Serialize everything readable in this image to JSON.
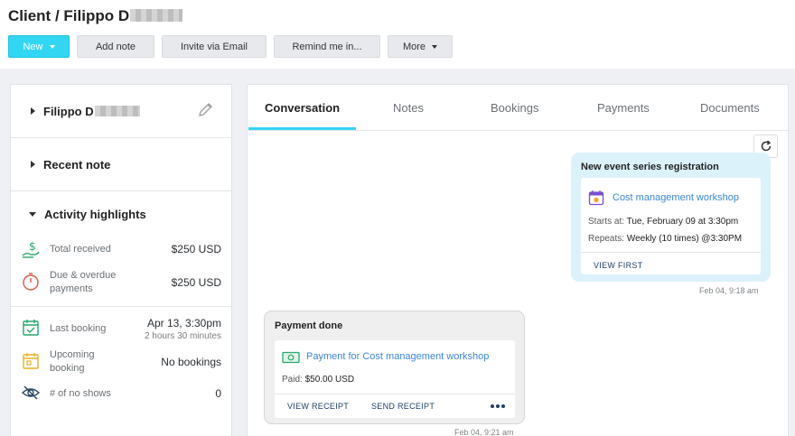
{
  "header": {
    "title": "Client / Filippo D",
    "buttons": {
      "new": "New",
      "add_note": "Add note",
      "invite": "Invite via Email",
      "remind": "Remind me in...",
      "more": "More"
    }
  },
  "left_panel": {
    "client_name": "Filippo D",
    "recent_note": "Recent note",
    "activity_title": "Activity highlights",
    "rows": {
      "total_received": {
        "label": "Total received",
        "value": "$250 USD"
      },
      "due_overdue": {
        "label": "Due & overdue payments",
        "value": "$250 USD"
      },
      "last_booking": {
        "label": "Last booking",
        "value": "Apr 13, 3:30pm",
        "sub": "2 hours 30 minutes"
      },
      "upcoming_booking": {
        "label": "Upcoming booking",
        "value": "No bookings"
      },
      "no_shows": {
        "label": "# of no shows",
        "value": "0"
      }
    }
  },
  "tabs": [
    "Conversation",
    "Notes",
    "Bookings",
    "Payments",
    "Documents"
  ],
  "active_tab": "Conversation",
  "colors": {
    "accent": "#33d6f2",
    "link": "#3b86d8",
    "bubble_blue": "#dcf2fb"
  },
  "messages": {
    "registration": {
      "title": "New event series registration",
      "event_name": "Cost management workshop",
      "starts_label": "Starts at:",
      "starts_value": "Tue, February 09 at 3:30pm",
      "repeats_label": "Repeats:",
      "repeats_value": "Weekly (10 times) @3:30PM",
      "action": "VIEW FIRST",
      "timestamp": "Feb 04, 9:18 am"
    },
    "payment": {
      "title": "Payment done",
      "link": "Payment for Cost management workshop",
      "paid_label": "Paid:",
      "paid_value": "$50.00 USD",
      "actions": {
        "view": "VIEW RECEIPT",
        "send": "SEND RECEIPT"
      },
      "timestamp": "Feb 04, 9:21 am"
    }
  }
}
